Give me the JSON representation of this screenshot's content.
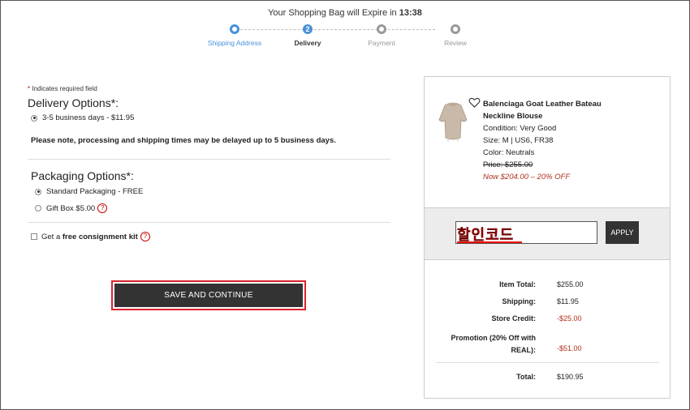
{
  "header": {
    "expire_prefix": "Your Shopping Bag will Expire in",
    "expire_time": "13:38"
  },
  "steps": [
    {
      "label": "Shipping Address",
      "number": ""
    },
    {
      "label": "Delivery",
      "number": "2"
    },
    {
      "label": "Payment",
      "number": ""
    },
    {
      "label": "Review",
      "number": ""
    }
  ],
  "form": {
    "required_note": "Indicates required field",
    "required_star": "*",
    "delivery_heading": "Delivery Options*:",
    "delivery_option": "3-5 business days - $11.95",
    "delay_note": "Please note, processing and shipping times may be delayed up to 5 business days.",
    "packaging_heading": "Packaging Options*:",
    "packaging_standard": "Standard Packaging - FREE",
    "packaging_gift": "Gift Box $5.00",
    "consign_prefix": "Get a",
    "consign_bold": "free consignment kit",
    "help_glyph": "?",
    "save_label": "SAVE AND CONTINUE"
  },
  "product": {
    "name_line1": "Balenciaga Goat Leather Bateau",
    "name_line2": "Neckline Blouse",
    "condition": "Condition: Very Good",
    "size": "Size: M | US6, FR38",
    "color": "Color: Neutrals",
    "price": "Price: $255.00",
    "now": "Now $204.00 – 20% OFF"
  },
  "promo": {
    "code_text": "할인코드",
    "apply_label": "APPLY"
  },
  "totals": {
    "item_total_label": "Item Total:",
    "item_total": "$255.00",
    "shipping_label": "Shipping:",
    "shipping": "$11.95",
    "store_credit_label": "Store Credit:",
    "store_credit": "-$25.00",
    "promotion_label_1": "Promotion (20% Off with",
    "promotion_label_2": "REAL):",
    "promotion": "-$51.00",
    "total_label": "Total:",
    "total": "$190.95"
  },
  "colors": {
    "accent": "#4a90d9",
    "button": "#333333",
    "discount": "#b0301e",
    "highlight": "#d9232d"
  }
}
